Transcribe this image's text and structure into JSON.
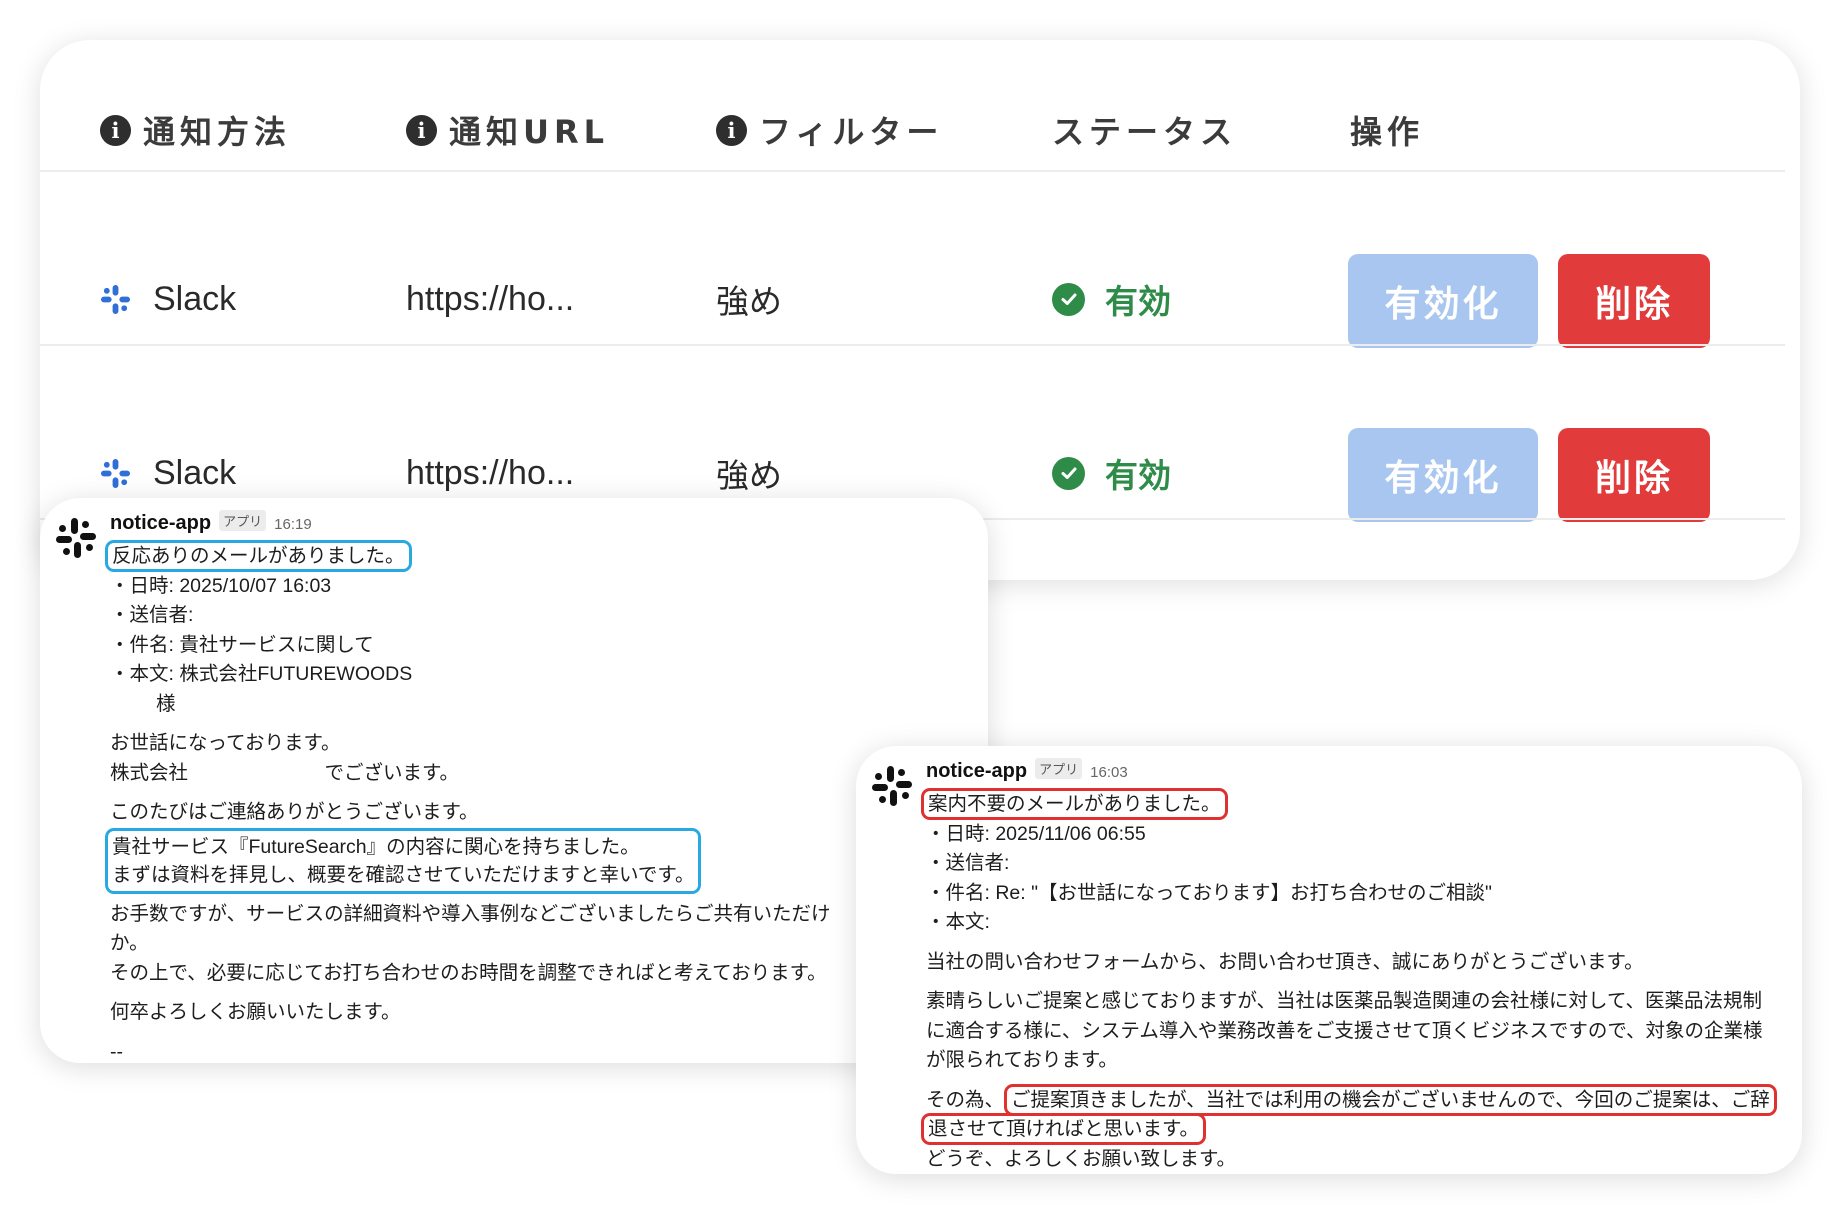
{
  "table": {
    "headers": [
      {
        "label": "通知方法",
        "info": true
      },
      {
        "label": "通知URL",
        "info": true
      },
      {
        "label": "フィルター",
        "info": true
      },
      {
        "label": "ステータス",
        "info": false
      },
      {
        "label": "操作",
        "info": false
      }
    ],
    "rows": [
      {
        "method": "Slack",
        "url": "https://ho...",
        "filter": "強め",
        "status": "有効",
        "enable_label": "有効化",
        "delete_label": "削除"
      },
      {
        "method": "Slack",
        "url": "https://ho...",
        "filter": "強め",
        "status": "有効",
        "enable_label": "有効化",
        "delete_label": "削除"
      }
    ]
  },
  "messages": [
    {
      "sender": "notice-app",
      "badge": "アプリ",
      "time": "16:19",
      "title": "反応ありのメールがありました。",
      "meta": [
        "・日時: 2025/10/07 16:03",
        "・送信者:",
        "・件名: 貴社サービスに関して",
        "・本文: 株式会社FUTUREWOODS"
      ],
      "honorific": "様",
      "paragraphs": [
        [
          "お世話になっております。",
          "株式会社　　　　　　　でございます。"
        ],
        [
          "このたびはご連絡ありがとうございます。"
        ]
      ],
      "highlight": [
        "貴社サービス『FutureSearch』の内容に関心を持ちました。",
        "まずは資料を拝見し、概要を確認させていただけますと幸いです。"
      ],
      "after": [
        [
          "お手数ですが、サービスの詳細資料や導入事例などございましたらご共有いただけ",
          "か。",
          "その上で、必要に応じてお打ち合わせのお時間を調整できればと考えております。"
        ],
        [
          "何卒よろしくお願いいたします。"
        ],
        [
          "--"
        ]
      ]
    },
    {
      "sender": "notice-app",
      "badge": "アプリ",
      "time": "16:03",
      "title": "案内不要のメールがありました。",
      "meta": [
        "・日時: 2025/11/06 06:55",
        "・送信者:",
        "・件名: Re: \"【お世話になっております】お打ち合わせのご相談\"",
        "・本文:"
      ],
      "paragraphs": [
        [
          "当社の問い合わせフォームから、お問い合わせ頂き、誠にありがとうございます。"
        ],
        [
          "素晴らしいご提案と感じておりますが、当社は医薬品製造関連の会社様に対して、医薬品法規制",
          "に適合する様に、システム導入や業務改善をご支援させて頂くビジネスですので、対象の企業様",
          "が限られております。"
        ]
      ],
      "closing_prefix": "その為、",
      "closing_highlight_1": "ご提案頂きましたが、当社では利用の機会がございませんので、今回のご提案は、ご辞",
      "closing_highlight_2": "退させて頂ければと思います。",
      "closing_last": "どうぞ、よろしくお願い致します。"
    }
  ],
  "colors": {
    "status_green": "#2e8b48",
    "enable_button": "#a8c6f0",
    "delete_button": "#e23b3b",
    "highlight_blue": "#29a9e1",
    "highlight_red": "#e03131"
  }
}
